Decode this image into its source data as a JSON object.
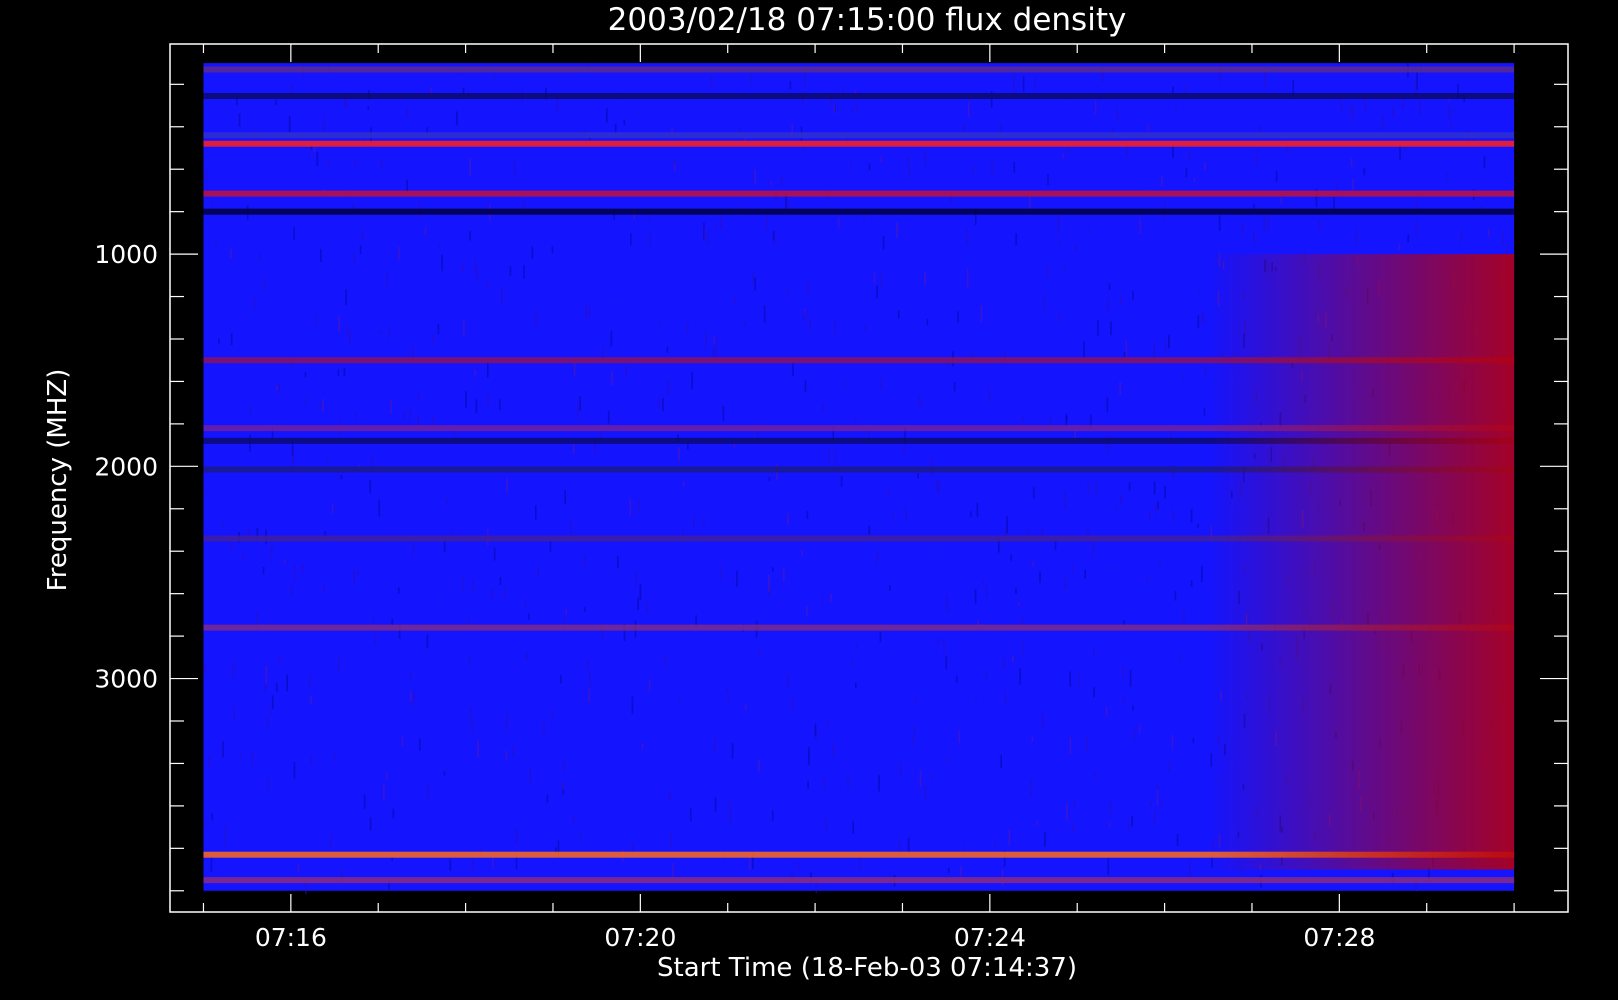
{
  "chart_data": {
    "type": "heatmap",
    "title": "2003/02/18 07:15:00 flux density",
    "xlabel": "Start Time (18-Feb-03 07:14:37)",
    "ylabel": "Frequency (MHZ)",
    "x_ticks": [
      "07:16",
      "07:20",
      "07:24",
      "07:28"
    ],
    "y_ticks": [
      1000,
      2000,
      3000
    ],
    "x_range_minutes": [
      14.617,
      30.617
    ],
    "data_x_range_minutes": [
      15.0,
      30.0
    ],
    "y_range_mhz": [
      10,
      4100
    ],
    "data_y_range_mhz": [
      100,
      4000
    ],
    "colormap": [
      "#000000",
      "#1010ff",
      "#ff1010",
      "#ffffff"
    ],
    "background_color": "#1414ff",
    "late_enhancement": {
      "start_minute": 26.5,
      "end_minute": 30.0,
      "peak_color": "#b4000f",
      "freq_range_mhz": [
        1000,
        3900
      ]
    },
    "bands": [
      {
        "freq_mhz": 130,
        "color": "#5a2a90"
      },
      {
        "freq_mhz": 255,
        "color": "#0a0a6a"
      },
      {
        "freq_mhz": 440,
        "color": "#3030d0"
      },
      {
        "freq_mhz": 480,
        "color": "#ff2020"
      },
      {
        "freq_mhz": 715,
        "color": "#c01040"
      },
      {
        "freq_mhz": 800,
        "color": "#000040"
      },
      {
        "freq_mhz": 1500,
        "color": "#8a1060"
      },
      {
        "freq_mhz": 1820,
        "color": "#7020a0"
      },
      {
        "freq_mhz": 1880,
        "color": "#0a0a70"
      },
      {
        "freq_mhz": 2015,
        "color": "#1a1a8a"
      },
      {
        "freq_mhz": 2340,
        "color": "#4020a0"
      },
      {
        "freq_mhz": 2760,
        "color": "#7a2a8a"
      },
      {
        "freq_mhz": 3830,
        "color": "#ff6a1a"
      },
      {
        "freq_mhz": 3950,
        "color": "#8a2a80"
      }
    ],
    "grid": false
  }
}
